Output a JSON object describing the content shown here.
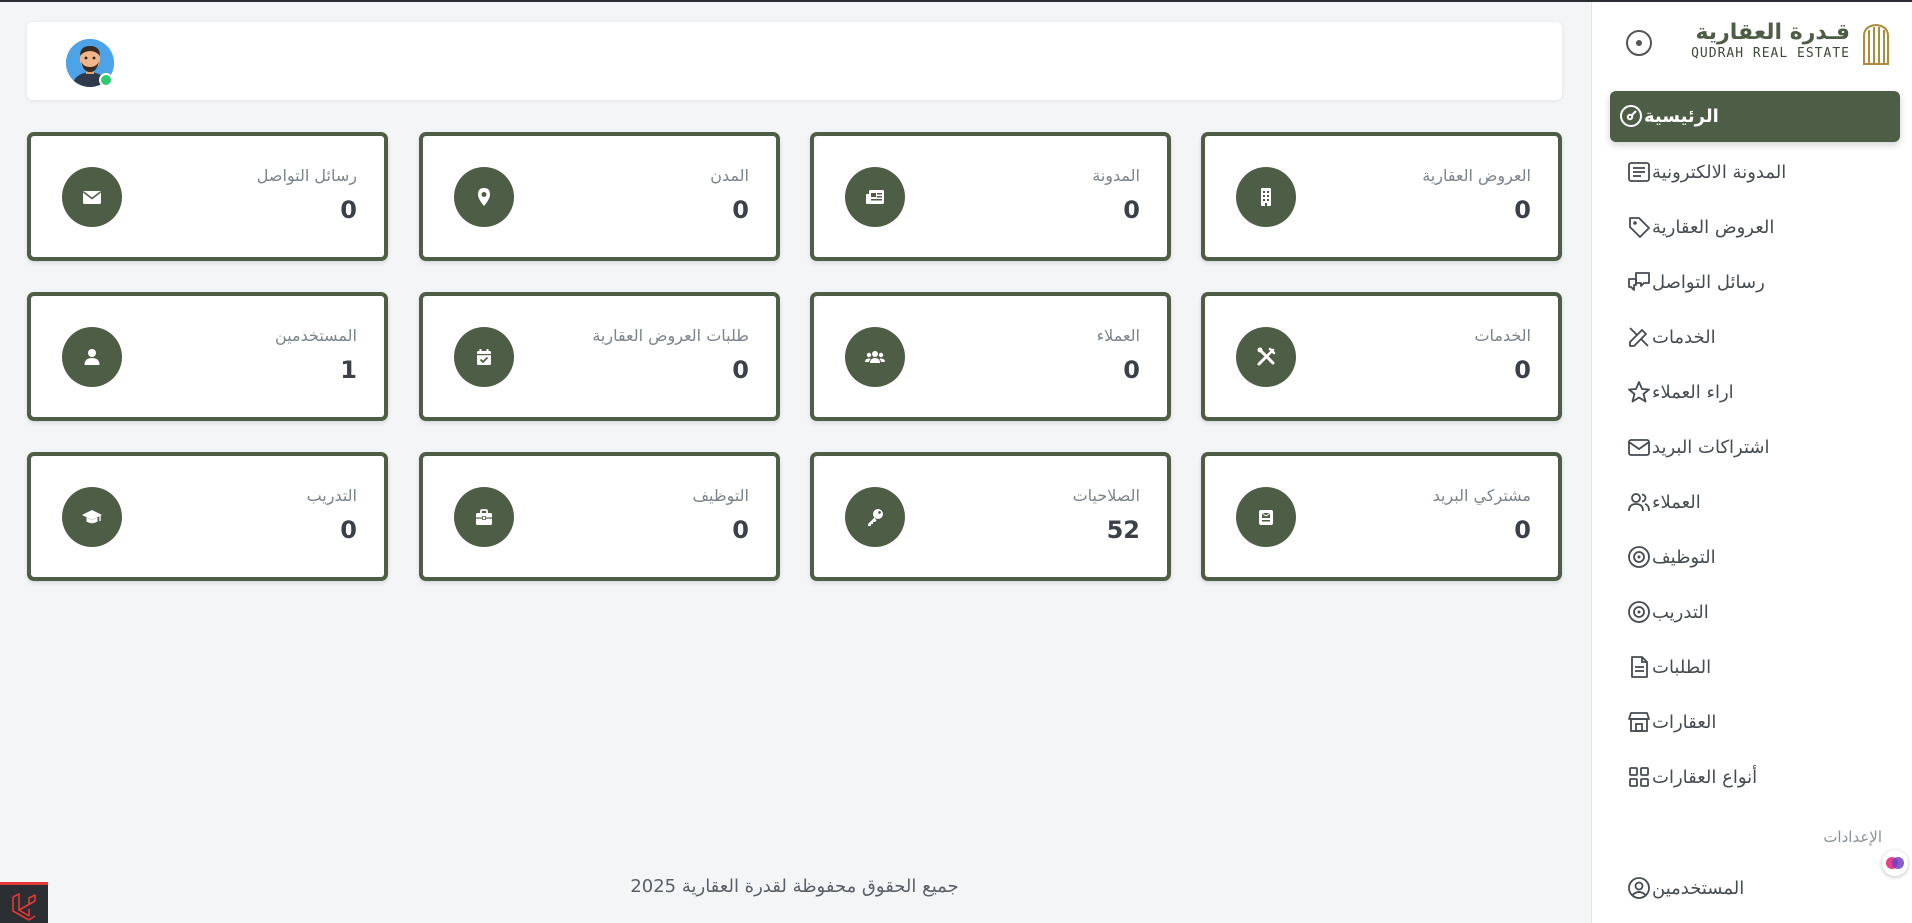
{
  "brand": {
    "name_ar": "قـدرة العقارية",
    "name_en": "QUDRAH REAL ESTATE"
  },
  "sidebar": {
    "items": [
      {
        "label": "الرئيسية",
        "icon": "dashboard-gauge-icon",
        "active": true
      },
      {
        "label": "المدونة الالكترونية",
        "icon": "newspaper-icon"
      },
      {
        "label": "العروض العقارية",
        "icon": "tag-icon"
      },
      {
        "label": "رسائل التواصل",
        "icon": "messages-icon"
      },
      {
        "label": "الخدمات",
        "icon": "tools-icon"
      },
      {
        "label": "اراء العملاء",
        "icon": "star-icon"
      },
      {
        "label": "اشتراكات البريد",
        "icon": "mail-icon"
      },
      {
        "label": "العملاء",
        "icon": "users-icon"
      },
      {
        "label": "التوظيف",
        "icon": "target-icon"
      },
      {
        "label": "التدريب",
        "icon": "target-icon"
      },
      {
        "label": "الطلبات",
        "icon": "document-icon"
      },
      {
        "label": "العقارات",
        "icon": "building-store-icon"
      },
      {
        "label": "أنواع العقارات",
        "icon": "grid-icon"
      }
    ],
    "section_settings": "الإعدادات",
    "settings_items": [
      {
        "label": "المستخدمين",
        "icon": "user-circle-icon"
      }
    ]
  },
  "cards": [
    {
      "title": "العروض العقارية",
      "value": "0",
      "icon": "building-icon"
    },
    {
      "title": "المدونة",
      "value": "0",
      "icon": "newspaper-icon"
    },
    {
      "title": "المدن",
      "value": "0",
      "icon": "location-pin-icon"
    },
    {
      "title": "رسائل التواصل",
      "value": "0",
      "icon": "envelope-icon"
    },
    {
      "title": "الخدمات",
      "value": "0",
      "icon": "tools-icon"
    },
    {
      "title": "العملاء",
      "value": "0",
      "icon": "users-icon"
    },
    {
      "title": "طلبات العروض العقارية",
      "value": "0",
      "icon": "calendar-check-icon"
    },
    {
      "title": "المستخدمين",
      "value": "1",
      "icon": "user-icon"
    },
    {
      "title": "مشتركي البريد",
      "value": "0",
      "icon": "mail-box-icon"
    },
    {
      "title": "الصلاحيات",
      "value": "52",
      "icon": "key-icon"
    },
    {
      "title": "التوظيف",
      "value": "0",
      "icon": "briefcase-icon"
    },
    {
      "title": "التدريب",
      "value": "0",
      "icon": "graduation-cap-icon"
    }
  ],
  "footer": {
    "text": "جميع الحقوق محفوظة لقدرة العقارية 2025"
  },
  "colors": {
    "primary": "#4e5e46",
    "online": "#2ecc71"
  }
}
